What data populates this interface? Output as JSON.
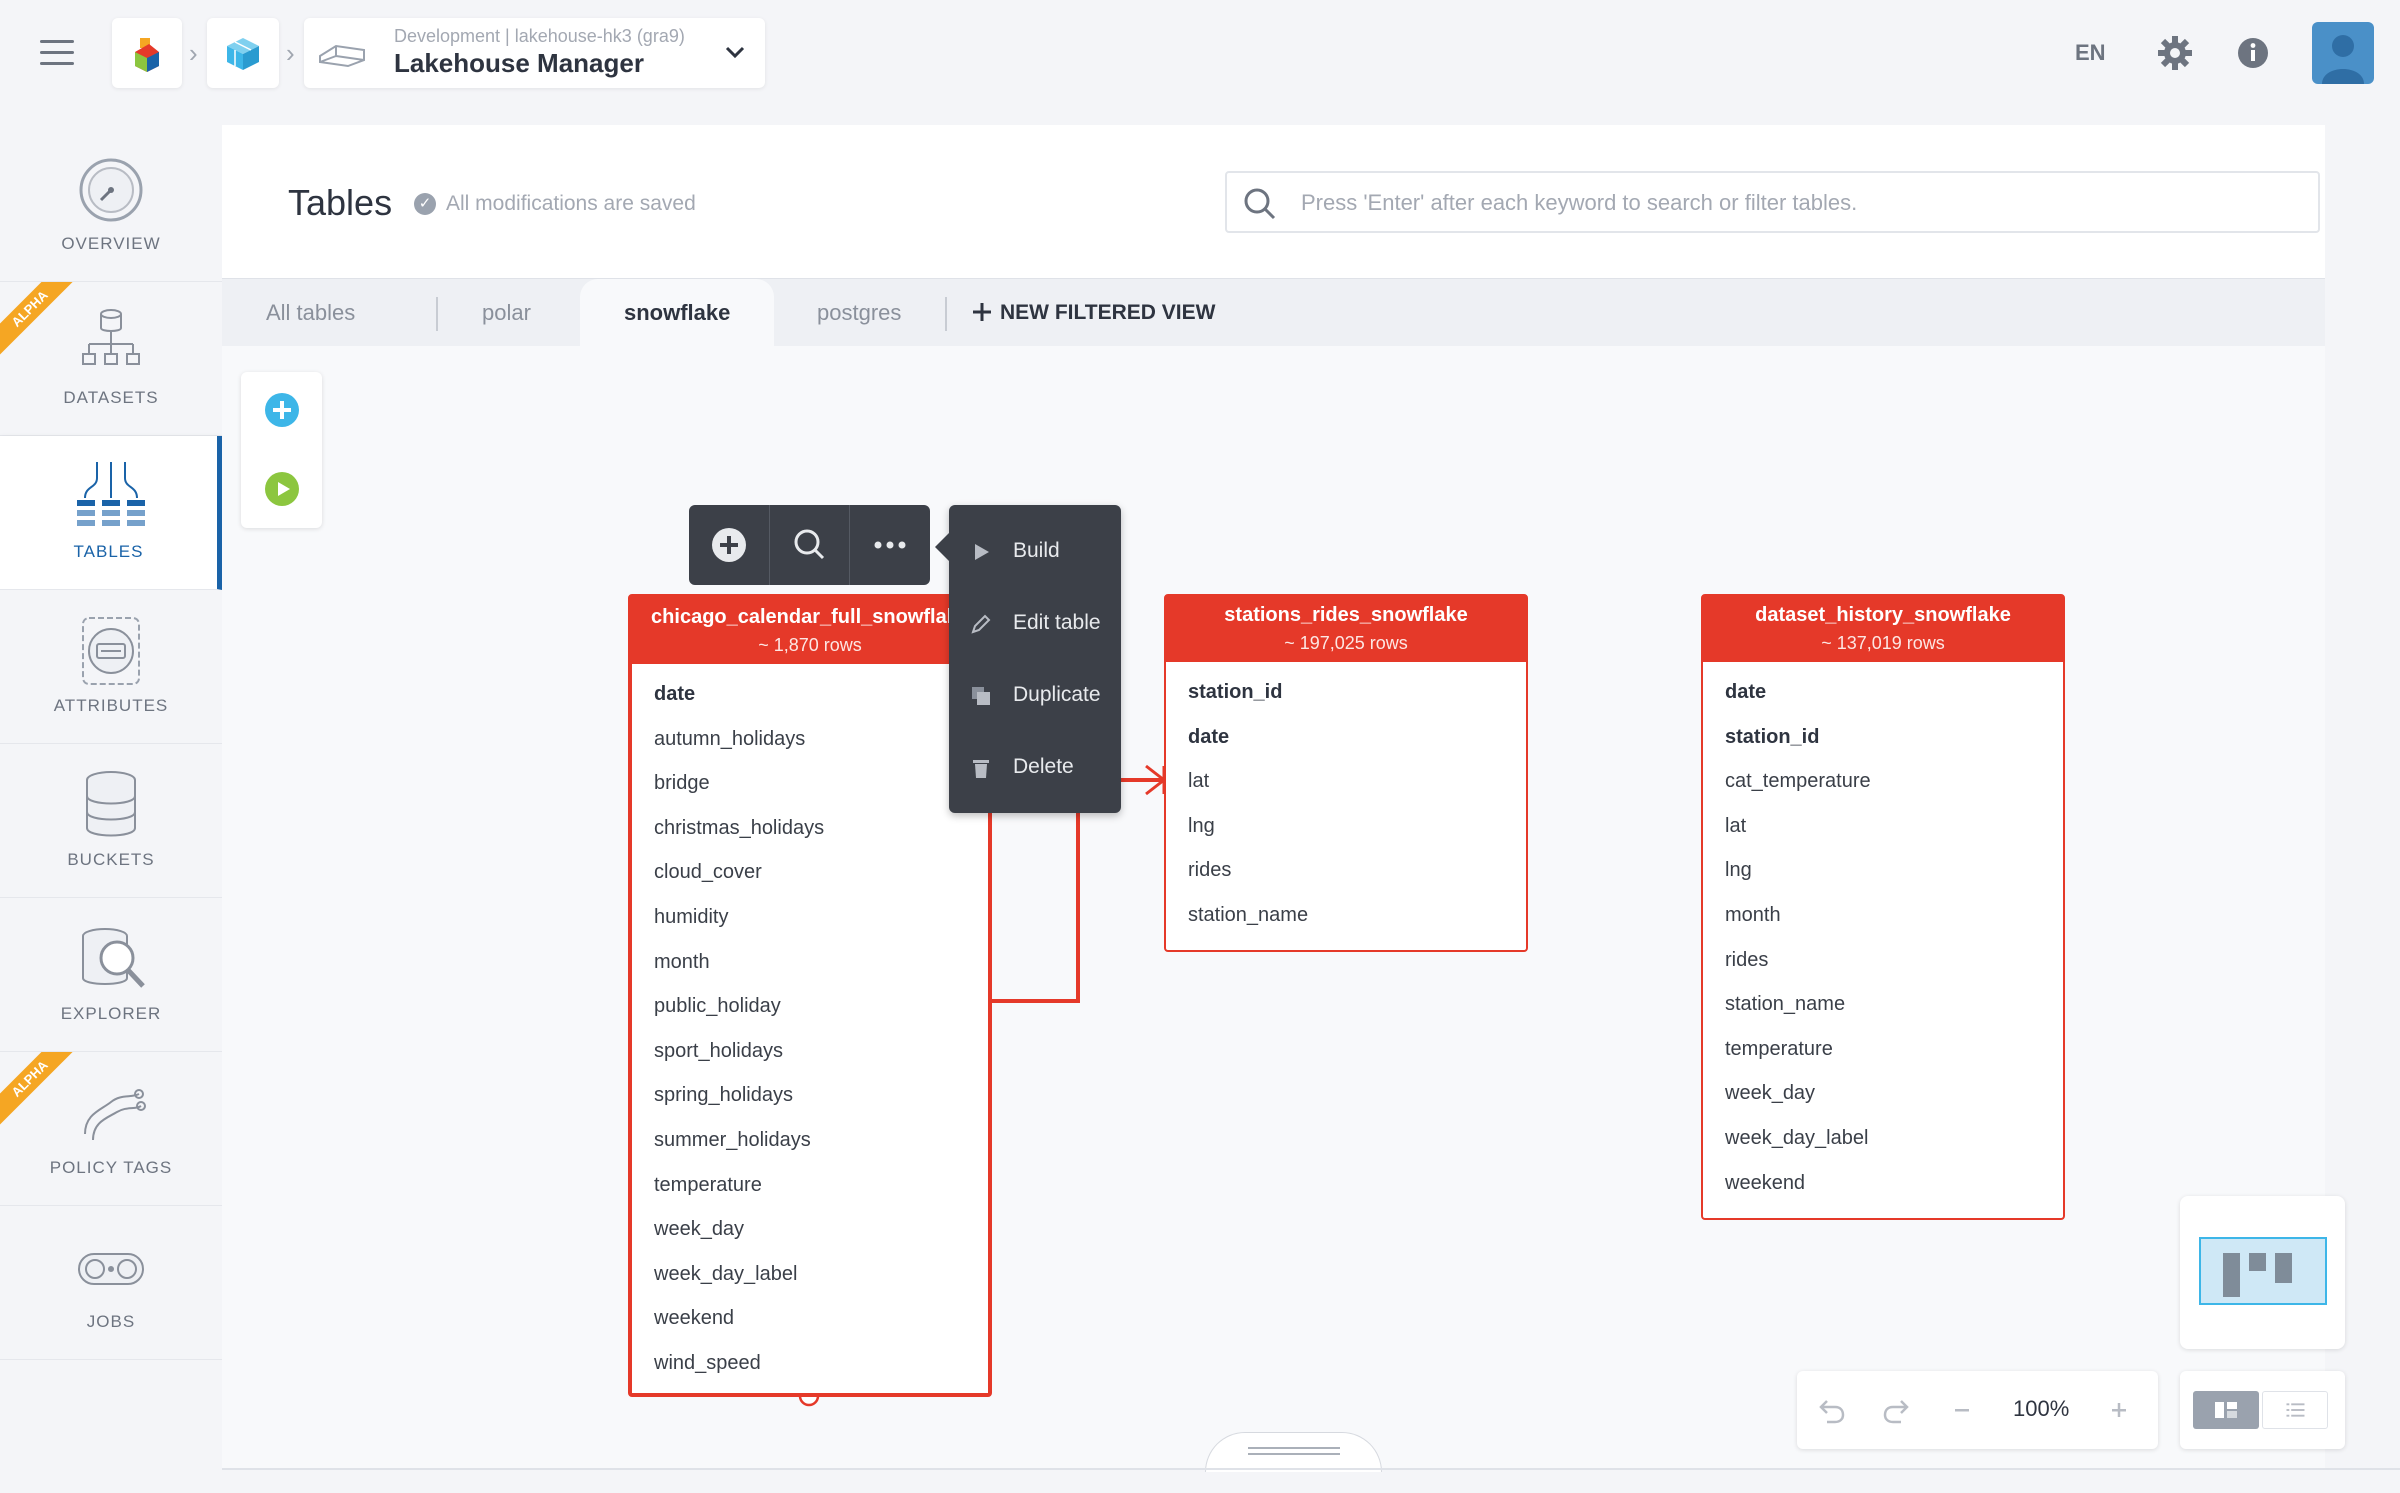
{
  "header": {
    "project_context": "Development | lakehouse-hk3 (gra9)",
    "project_title": "Lakehouse Manager",
    "language": "EN"
  },
  "sidebar": {
    "items": [
      {
        "label": "OVERVIEW",
        "icon": "gauge-icon",
        "alpha": false
      },
      {
        "label": "DATASETS",
        "icon": "dataset-tree-icon",
        "alpha": true
      },
      {
        "label": "TABLES",
        "icon": "tables-icon",
        "alpha": false,
        "active": true
      },
      {
        "label": "ATTRIBUTES",
        "icon": "attributes-icon",
        "alpha": false
      },
      {
        "label": "BUCKETS",
        "icon": "database-icon",
        "alpha": false
      },
      {
        "label": "EXPLORER",
        "icon": "magnifier-db-icon",
        "alpha": false
      },
      {
        "label": "POLICY TAGS",
        "icon": "policy-tags-icon",
        "alpha": true
      },
      {
        "label": "JOBS",
        "icon": "jobs-icon",
        "alpha": false
      }
    ],
    "alpha_badge": "ALPHA"
  },
  "page": {
    "title": "Tables",
    "save_status": "All modifications are saved",
    "search_placeholder": "Press 'Enter' after each keyword to search or filter tables."
  },
  "tabs": {
    "items": [
      "All tables",
      "polar",
      "snowflake",
      "postgres"
    ],
    "active": "snowflake",
    "new_view": "NEW FILTERED VIEW"
  },
  "context_menu": {
    "items": [
      "Build",
      "Edit table",
      "Duplicate",
      "Delete"
    ]
  },
  "tables": [
    {
      "name": "chicago_calendar_full_snowflake",
      "rows": "~ 1,870 rows",
      "columns": [
        "date",
        "autumn_holidays",
        "bridge",
        "christmas_holidays",
        "cloud_cover",
        "humidity",
        "month",
        "public_holiday",
        "sport_holidays",
        "spring_holidays",
        "summer_holidays",
        "temperature",
        "week_day",
        "week_day_label",
        "weekend",
        "wind_speed"
      ],
      "primary_keys": [
        "date"
      ]
    },
    {
      "name": "stations_rides_snowflake",
      "rows": "~ 197,025 rows",
      "columns": [
        "station_id",
        "date",
        "lat",
        "lng",
        "rides",
        "station_name"
      ],
      "primary_keys": [
        "station_id",
        "date"
      ]
    },
    {
      "name": "dataset_history_snowflake",
      "rows": "~ 137,019 rows",
      "columns": [
        "date",
        "station_id",
        "cat_temperature",
        "lat",
        "lng",
        "month",
        "rides",
        "station_name",
        "temperature",
        "week_day",
        "week_day_label",
        "weekend"
      ],
      "primary_keys": [
        "date",
        "station_id"
      ]
    }
  ],
  "zoom": {
    "level": "100%"
  },
  "colors": {
    "accent": "#1a63a8",
    "table_header": "#e53929",
    "alpha_badge": "#f5a623",
    "add_button": "#3db6e8",
    "run_button": "#8cc63f",
    "dark_menu": "#3c4048"
  }
}
